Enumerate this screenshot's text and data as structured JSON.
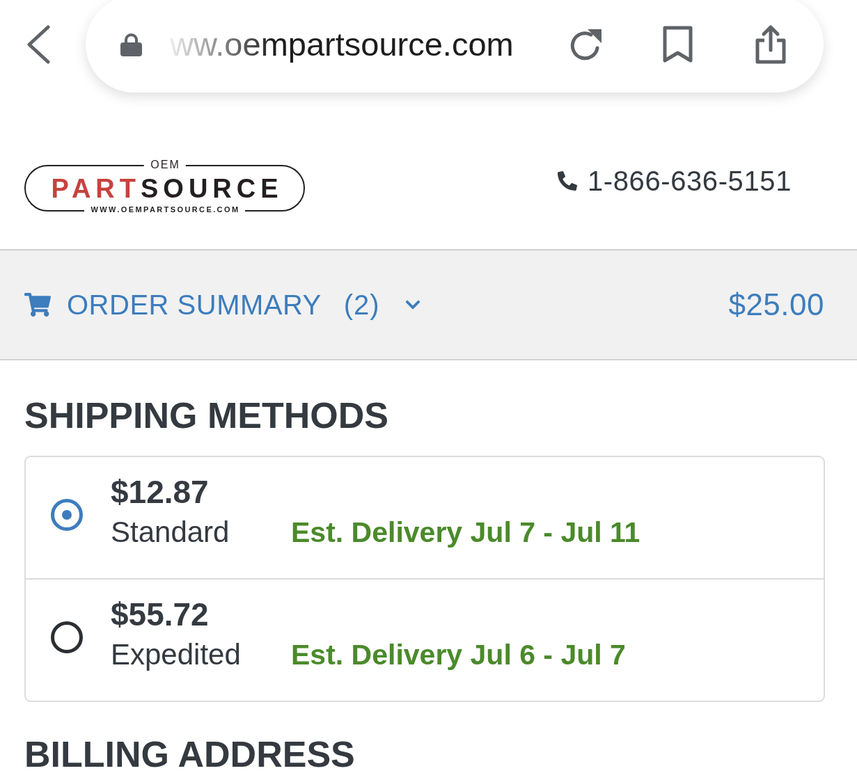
{
  "browser": {
    "url": "ww.oempartsource.com"
  },
  "header": {
    "logo": {
      "top": "OEM",
      "wordmark": [
        "PART",
        "SOURCE"
      ],
      "url": "WWW.OEMPARTSOURCE.COM"
    },
    "phone": "1-866-636-5151"
  },
  "order_summary": {
    "label": "ORDER SUMMARY",
    "count": "(2)",
    "expanded": false,
    "total": "$25.00"
  },
  "shipping": {
    "title": "SHIPPING METHODS",
    "options": [
      {
        "price": "$12.87",
        "name": "Standard",
        "delivery": "Est. Delivery Jul 7 - Jul 11",
        "selected": true
      },
      {
        "price": "$55.72",
        "name": "Expedited",
        "delivery": "Est. Delivery Jul 6 - Jul 7",
        "selected": false
      }
    ]
  },
  "billing": {
    "title": "BILLING ADDRESS"
  }
}
